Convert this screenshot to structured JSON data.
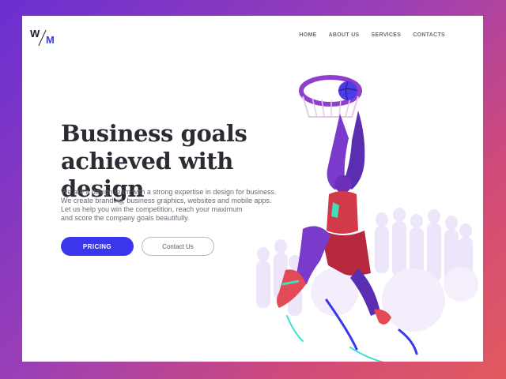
{
  "logo": {
    "left": "W",
    "right": "M"
  },
  "nav": {
    "items": [
      "HOME",
      "ABOUT US",
      "SERVICES",
      "CONTACTS"
    ]
  },
  "hero": {
    "headline_line1": "Business goals",
    "headline_line2": "achieved with design",
    "description_lines": [
      "We are a design team with a strong expertise in design for business.",
      "We create branding, business graphics, websites and mobile apps.",
      "Let us help you win the competition, reach your maximum",
      "and score the company goals beautifully."
    ],
    "primary_button": "PRICING",
    "secondary_button": "Contact Us"
  },
  "colors": {
    "accent": "#3a36ec",
    "heading": "#2b2b33",
    "background_gradient_start": "#6a2fd0",
    "background_gradient_end": "#e25a5e"
  },
  "icons": [
    "logo-wm-icon",
    "basketball-player-illustration"
  ]
}
